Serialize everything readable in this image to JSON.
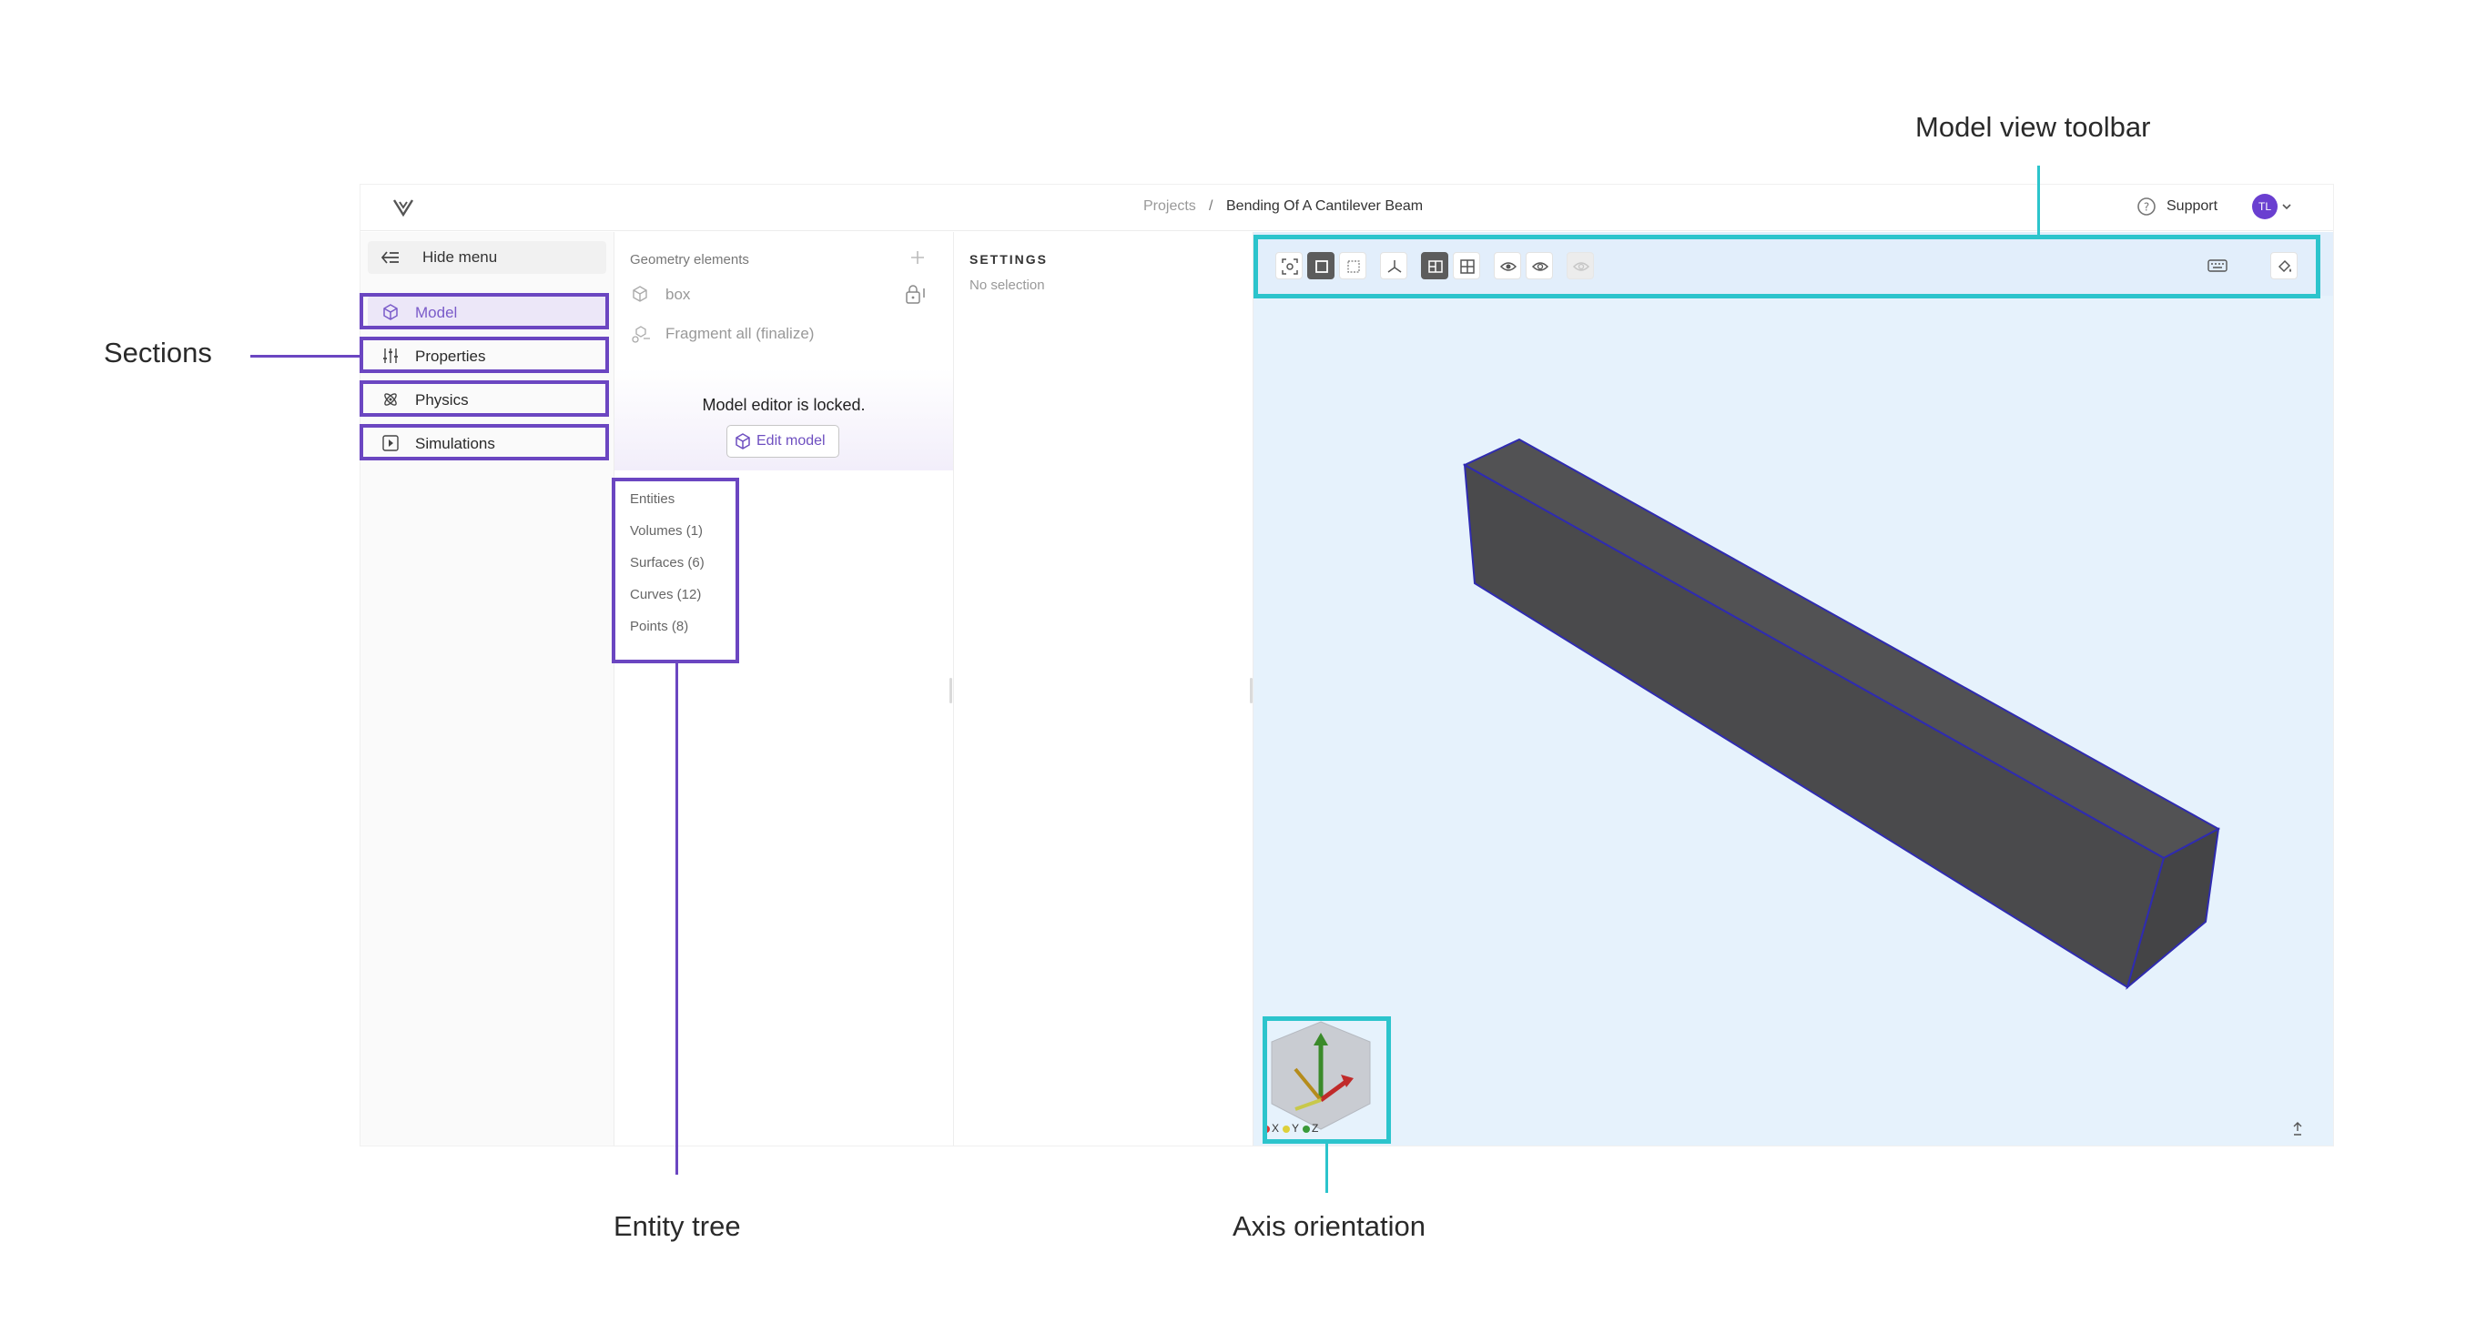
{
  "annotations": {
    "model_view_toolbar": "Model view toolbar",
    "sections": "Sections",
    "entity_tree": "Entity tree",
    "axis_orientation": "Axis orientation"
  },
  "colors": {
    "accent": "#6e4fc0",
    "highlight_purple": "#6b46c1",
    "highlight_teal": "#2cc4cc",
    "viewport_bg": "#e6f2fc",
    "beam_fill": "#4c4c4e",
    "beam_edge": "#2f2bb0"
  },
  "topbar": {
    "logo_icon": "logo-icon",
    "breadcrumb_root": "Projects",
    "breadcrumb_sep": "/",
    "breadcrumb_current": "Bending Of A Cantilever Beam",
    "support_label": "Support",
    "avatar_initials": "TL"
  },
  "nav": {
    "hide_menu": "Hide menu",
    "items": [
      {
        "label": "Model",
        "icon": "cube-icon",
        "active": true
      },
      {
        "label": "Properties",
        "icon": "sliders-icon"
      },
      {
        "label": "Physics",
        "icon": "atom-icon"
      },
      {
        "label": "Simulations",
        "icon": "play-icon"
      }
    ]
  },
  "geometry": {
    "header": "Geometry elements",
    "items": [
      "box",
      "Fragment all (finalize)"
    ],
    "locked_message": "Model editor is locked.",
    "edit_button": "Edit model",
    "entity_tree": [
      "Entities",
      "Volumes (1)",
      "Surfaces (6)",
      "Curves (12)",
      "Points (8)"
    ]
  },
  "settings": {
    "title": "SETTINGS",
    "empty": "No selection"
  },
  "viewport": {
    "axis_labels": [
      "X",
      "Y",
      "Z"
    ]
  }
}
